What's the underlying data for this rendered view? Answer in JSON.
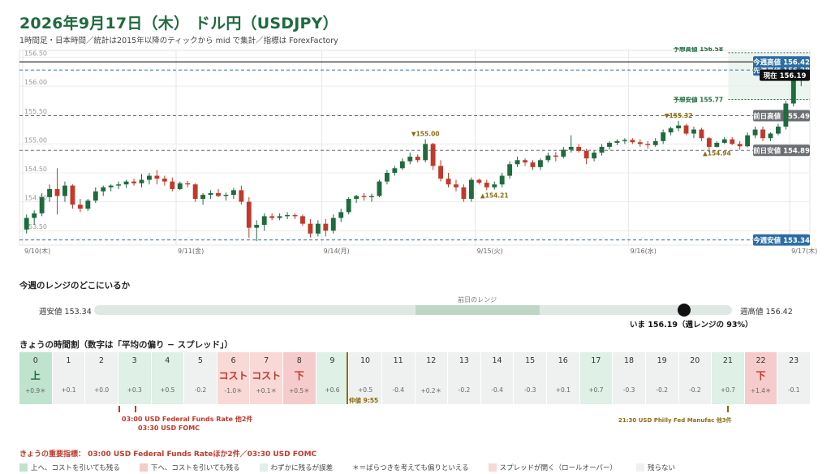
{
  "header": {
    "title": "2026年9月17日（木） ドル円（USDJPY）",
    "subtitle": "1時間足・日本時間／統計は2015年以降のティックから mid で集計／指標は ForexFactory"
  },
  "chart_data": {
    "type": "candlestick",
    "y_ticks": [
      "156.50",
      "156.00",
      "155.50",
      "155.00",
      "154.50",
      "154.00",
      "153.50"
    ],
    "ylim": [
      153.25,
      156.62
    ],
    "x_labels": [
      "9/10(木)",
      "9/11(金)",
      "9/14(月)",
      "9/15(火)",
      "9/16(水)",
      "9/17(木)"
    ],
    "candles": [
      [
        153.52,
        153.78,
        153.45,
        153.72
      ],
      [
        153.72,
        153.85,
        153.6,
        153.8
      ],
      [
        153.8,
        154.15,
        153.75,
        154.08
      ],
      [
        154.08,
        154.3,
        154.0,
        154.22
      ],
      [
        154.22,
        154.58,
        153.78,
        154.1
      ],
      [
        154.1,
        154.35,
        154.0,
        154.28
      ],
      [
        154.28,
        154.3,
        153.88,
        153.95
      ],
      [
        153.95,
        154.05,
        153.82,
        153.88
      ],
      [
        153.88,
        154.05,
        153.84,
        154.02
      ],
      [
        154.02,
        154.25,
        153.98,
        154.18
      ],
      [
        154.18,
        154.28,
        154.1,
        154.25
      ],
      [
        154.25,
        154.3,
        154.18,
        154.28
      ],
      [
        154.28,
        154.35,
        154.22,
        154.3
      ],
      [
        154.3,
        154.38,
        154.24,
        154.35
      ],
      [
        154.35,
        154.4,
        154.28,
        154.32
      ],
      [
        154.32,
        154.48,
        154.25,
        154.38
      ],
      [
        154.38,
        154.5,
        154.3,
        154.45
      ],
      [
        154.45,
        154.55,
        154.3,
        154.4
      ],
      [
        154.4,
        154.45,
        154.28,
        154.35
      ],
      [
        154.35,
        154.42,
        154.18,
        154.22
      ],
      [
        154.22,
        154.35,
        154.2,
        154.32
      ],
      [
        154.32,
        154.36,
        154.25,
        154.3
      ],
      [
        154.3,
        154.32,
        154.0,
        154.05
      ],
      [
        154.05,
        154.15,
        153.95,
        154.12
      ],
      [
        154.12,
        154.2,
        154.05,
        154.15
      ],
      [
        154.15,
        154.22,
        154.08,
        154.1
      ],
      [
        154.1,
        154.16,
        154.02,
        154.12
      ],
      [
        154.12,
        154.24,
        154.05,
        154.2
      ],
      [
        154.2,
        154.28,
        153.95,
        154.0
      ],
      [
        154.0,
        154.08,
        153.38,
        153.55
      ],
      [
        153.55,
        153.68,
        153.32,
        153.6
      ],
      [
        153.6,
        153.8,
        153.5,
        153.75
      ],
      [
        153.75,
        153.8,
        153.68,
        153.72
      ],
      [
        153.72,
        153.8,
        153.68,
        153.75
      ],
      [
        153.75,
        153.82,
        153.7,
        153.77
      ],
      [
        153.77,
        153.8,
        153.7,
        153.75
      ],
      [
        153.75,
        153.78,
        153.58,
        153.62
      ],
      [
        153.62,
        153.7,
        153.38,
        153.45
      ],
      [
        153.45,
        153.68,
        153.4,
        153.62
      ],
      [
        153.62,
        153.7,
        153.4,
        153.5
      ],
      [
        153.5,
        153.78,
        153.45,
        153.72
      ],
      [
        153.72,
        153.88,
        153.65,
        153.82
      ],
      [
        153.82,
        154.08,
        153.78,
        154.05
      ],
      [
        154.05,
        154.12,
        153.98,
        154.1
      ],
      [
        154.1,
        154.15,
        154.02,
        154.08
      ],
      [
        154.08,
        154.14,
        154.0,
        154.1
      ],
      [
        154.1,
        154.38,
        154.08,
        154.35
      ],
      [
        154.35,
        154.55,
        154.3,
        154.5
      ],
      [
        154.5,
        154.62,
        154.45,
        154.58
      ],
      [
        154.58,
        154.75,
        154.55,
        154.7
      ],
      [
        154.7,
        154.85,
        154.65,
        154.78
      ],
      [
        154.78,
        154.82,
        154.68,
        154.72
      ],
      [
        154.72,
        155.08,
        154.68,
        155.0
      ],
      [
        155.0,
        155.02,
        154.55,
        154.62
      ],
      [
        154.62,
        154.72,
        154.35,
        154.4
      ],
      [
        154.4,
        154.5,
        154.25,
        154.3
      ],
      [
        154.3,
        154.38,
        154.18,
        154.25
      ],
      [
        154.25,
        154.3,
        154.0,
        154.05
      ],
      [
        154.05,
        154.42,
        154.0,
        154.38
      ],
      [
        154.38,
        154.4,
        154.3,
        154.33
      ],
      [
        154.33,
        154.38,
        154.2,
        154.25
      ],
      [
        154.25,
        154.35,
        154.21,
        154.3
      ],
      [
        154.3,
        154.5,
        154.25,
        154.45
      ],
      [
        154.45,
        154.7,
        154.4,
        154.65
      ],
      [
        154.65,
        154.78,
        154.6,
        154.72
      ],
      [
        154.72,
        154.75,
        154.62,
        154.68
      ],
      [
        154.68,
        154.72,
        154.55,
        154.6
      ],
      [
        154.6,
        154.75,
        154.55,
        154.72
      ],
      [
        154.72,
        154.85,
        154.68,
        154.8
      ],
      [
        154.8,
        154.86,
        154.7,
        154.78
      ],
      [
        154.78,
        154.95,
        154.75,
        154.9
      ],
      [
        154.9,
        155.15,
        154.85,
        154.95
      ],
      [
        154.95,
        155.0,
        154.85,
        154.88
      ],
      [
        154.88,
        154.92,
        154.65,
        154.75
      ],
      [
        154.75,
        154.88,
        154.7,
        154.85
      ],
      [
        154.85,
        155.0,
        154.8,
        154.95
      ],
      [
        154.95,
        155.05,
        154.9,
        155.02
      ],
      [
        155.02,
        155.08,
        154.98,
        155.05
      ],
      [
        155.05,
        155.1,
        155.0,
        155.07
      ],
      [
        155.07,
        155.1,
        155.0,
        155.03
      ],
      [
        155.03,
        155.08,
        154.95,
        155.0
      ],
      [
        155.0,
        155.05,
        154.92,
        154.98
      ],
      [
        154.98,
        155.1,
        154.95,
        155.05
      ],
      [
        155.05,
        155.25,
        155.0,
        155.2
      ],
      [
        155.2,
        155.3,
        155.15,
        155.27
      ],
      [
        155.27,
        155.4,
        155.22,
        155.32
      ],
      [
        155.32,
        155.35,
        155.15,
        155.18
      ],
      [
        155.18,
        155.3,
        155.1,
        155.25
      ],
      [
        155.25,
        155.28,
        155.05,
        155.1
      ],
      [
        155.1,
        155.12,
        154.9,
        154.95
      ],
      [
        154.95,
        155.05,
        154.94,
        155.02
      ],
      [
        155.02,
        155.12,
        155.0,
        155.08
      ],
      [
        155.08,
        155.12,
        154.98,
        155.0
      ],
      [
        155.0,
        155.05,
        154.9,
        154.96
      ],
      [
        154.96,
        155.2,
        154.94,
        155.15
      ],
      [
        155.15,
        155.3,
        155.1,
        155.25
      ],
      [
        155.25,
        155.3,
        155.05,
        155.1
      ],
      [
        155.1,
        155.2,
        155.05,
        155.18
      ],
      [
        155.18,
        155.35,
        155.15,
        155.3
      ],
      [
        155.3,
        155.75,
        155.25,
        155.7
      ],
      [
        155.7,
        156.15,
        155.65,
        156.1
      ],
      [
        156.1,
        156.3,
        156.0,
        156.19
      ]
    ],
    "levels": [
      {
        "label": "先週高値 156.28",
        "value": 156.28,
        "style": "dash-blue"
      },
      {
        "label": "前日高値 155.49",
        "value": 155.49,
        "style": "dash-gray"
      },
      {
        "label": "前日安値 154.89",
        "value": 154.89,
        "style": "dash-gray"
      },
      {
        "label": "今週安値 153.34",
        "value": 153.34,
        "style": "dash-blue"
      },
      {
        "label": "今週高値 156.42",
        "value": 156.42,
        "style": "solid-dark"
      }
    ],
    "current": {
      "label": "現在 156.19",
      "value": 156.19
    },
    "forecast": {
      "high_label": "予想高値 156.58",
      "high": 156.58,
      "low_label": "予想安値 155.77",
      "low": 155.77
    },
    "annotations": [
      {
        "label": "▼155.00",
        "index": 52,
        "value": 155.08,
        "pos": "above"
      },
      {
        "label": "▲154.21",
        "index": 61,
        "value": 154.21,
        "pos": "below"
      },
      {
        "label": "▼155.32",
        "index": 85,
        "value": 155.4,
        "pos": "above"
      },
      {
        "label": "▲154.94",
        "index": 90,
        "value": 154.94,
        "pos": "below"
      }
    ],
    "colors": {
      "up": "#1e6b3d",
      "down": "#c0392b",
      "blue_tag": "#2e6da4",
      "gray_tag": "#6b6f73",
      "forecast": "#1e6b3d"
    }
  },
  "range_section": {
    "label": "今週のレンジのどこにいるか",
    "low_label": "週安値 153.34",
    "high_label": "週高値 156.42",
    "prev_day_label": "前日のレンジ",
    "prev_low": 154.89,
    "prev_high": 155.49,
    "week_low": 153.34,
    "week_high": 156.42,
    "current": 156.19,
    "now_label": "いま 156.19（週レンジの 93%）"
  },
  "hours_section": {
    "label": "きょうの時間割（数字は「平均の偏り − スプレッド」）",
    "hours": [
      {
        "h": "0",
        "sign": "上",
        "v": "+0.9＊",
        "k": "up"
      },
      {
        "h": "1",
        "sign": "",
        "v": "+0.1",
        "k": "none"
      },
      {
        "h": "2",
        "sign": "",
        "v": "+0.0",
        "k": "none"
      },
      {
        "h": "3",
        "sign": "",
        "v": "+0.3",
        "k": "mild"
      },
      {
        "h": "4",
        "sign": "",
        "v": "+0.5",
        "k": "mild"
      },
      {
        "h": "5",
        "sign": "",
        "v": "-0.2",
        "k": "none"
      },
      {
        "h": "6",
        "sign": "コスト",
        "v": "-1.0＊",
        "k": "cost"
      },
      {
        "h": "7",
        "sign": "コスト",
        "v": "+0.1＊",
        "k": "cost"
      },
      {
        "h": "8",
        "sign": "下",
        "v": "+0.5＊",
        "k": "down"
      },
      {
        "h": "9",
        "sign": "",
        "v": "+0.6",
        "k": "mild"
      },
      {
        "h": "10",
        "sign": "",
        "v": "+0.5",
        "k": "none"
      },
      {
        "h": "11",
        "sign": "",
        "v": "-0.4",
        "k": "none"
      },
      {
        "h": "12",
        "sign": "",
        "v": "+0.2＊",
        "k": "none"
      },
      {
        "h": "13",
        "sign": "",
        "v": "-0.2",
        "k": "none"
      },
      {
        "h": "14",
        "sign": "",
        "v": "-0.4",
        "k": "none"
      },
      {
        "h": "15",
        "sign": "",
        "v": "-0.3",
        "k": "none"
      },
      {
        "h": "16",
        "sign": "",
        "v": "+0.1",
        "k": "none"
      },
      {
        "h": "17",
        "sign": "",
        "v": "+0.7",
        "k": "mild"
      },
      {
        "h": "18",
        "sign": "",
        "v": "-0.3",
        "k": "none"
      },
      {
        "h": "19",
        "sign": "",
        "v": "-0.2",
        "k": "none"
      },
      {
        "h": "20",
        "sign": "",
        "v": "-0.2",
        "k": "none"
      },
      {
        "h": "21",
        "sign": "",
        "v": "+0.7",
        "k": "mild"
      },
      {
        "h": "22",
        "sign": "下",
        "v": "+1.4＊",
        "k": "down"
      },
      {
        "h": "23",
        "sign": "",
        "v": "-0.1",
        "k": "none"
      }
    ],
    "nakane_label": "仲値 9:55",
    "event_1": "03:00 USD Federal Funds Rate 他2件",
    "event_2": "03:30 USD FOMC",
    "event_3": "21:30 USD Philly Fed Manufac 他3件"
  },
  "key_events": "きょうの重要指標： 03:00 USD Federal Funds Rateほか2件／03:30 USD FOMC",
  "legend": [
    {
      "label": "上へ、コストを引いても残る",
      "color": "#bfe3cd"
    },
    {
      "label": "下へ、コストを引いても残る",
      "color": "#f5cccb"
    },
    {
      "label": "わずかに残るが誤差",
      "color": "#dff0e6"
    },
    {
      "label": "＊＝ばらつきを考えても偏りといえる",
      "color": ""
    },
    {
      "label": "スプレッドが開く（ロールオーバー）",
      "color": "#f8d9d6"
    },
    {
      "label": "残らない",
      "color": "#eef1ef"
    }
  ]
}
